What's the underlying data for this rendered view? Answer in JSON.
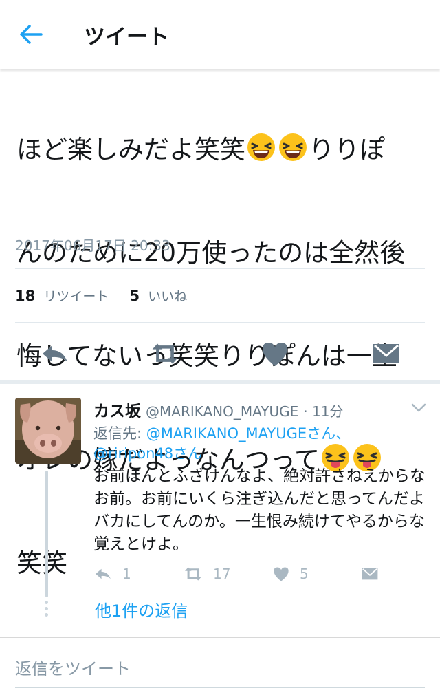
{
  "header": {
    "title": "ツイート",
    "back_icon": "arrow-left-icon",
    "accent": "#1da1f2"
  },
  "tweet": {
    "lines": [
      {
        "text": "ほど楽しみだよ笑笑",
        "emoji_after": [
          "grinning-squinting-face",
          "grinning-squinting-face"
        ],
        "tail": "りりぽ"
      },
      {
        "text": "んのために20万使ったのは全然後"
      },
      {
        "text": "悔してないっ笑笑りりぽんは一生"
      },
      {
        "text": "オレの嫁だよっなんつって",
        "emoji_after": [
          "tongue-squinting-face",
          "tongue-squinting-face"
        ]
      },
      {
        "text": "笑笑"
      }
    ],
    "timestamp": "2017年06月17日 20:33",
    "retweet_count": "18",
    "retweet_label": "リツイート",
    "like_count": "5",
    "like_label": "いいね"
  },
  "actions": [
    "reply-icon",
    "retweet-icon",
    "like-heart-icon",
    "direct-message-icon"
  ],
  "reply": {
    "name": "カス坂",
    "handle": "@MARIKANO_MAYUGE",
    "time": "· 11分",
    "reply_to_prefix": "返信先: ",
    "reply_to_1": "@MARIKANO_MAYUGEさん、",
    "reply_to_2": "@riripon48さん",
    "text": "お前ほんとふざけんなよ、絶対許さねえからなお前。お前にいくら注ぎ込んだと思ってんだよバカにしてんのか。一生恨み続けてやるからな覚えとけよ。",
    "reply_count": "1",
    "retweet_count": "17",
    "like_count": "5",
    "more_replies": "他1件の返信"
  },
  "compose": {
    "placeholder": "返信をツイート"
  }
}
